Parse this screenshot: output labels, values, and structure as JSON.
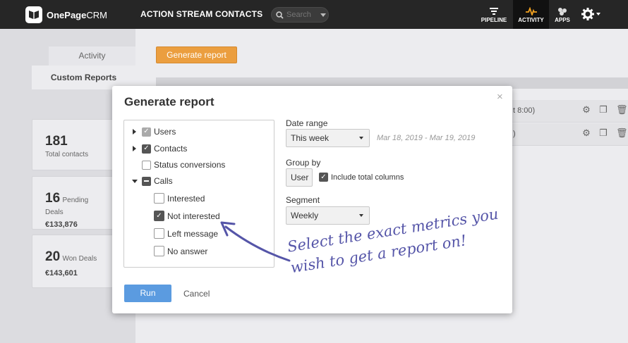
{
  "topbar": {
    "logo_bold": "OnePage",
    "logo_light": "CRM",
    "nav": [
      "ACTION STREAM",
      "CONTACTS"
    ],
    "search_placeholder": "Search",
    "right_nav": [
      {
        "label": "PIPELINE",
        "icon": "pipeline-icon"
      },
      {
        "label": "ACTIVITY",
        "icon": "activity-icon",
        "active": true
      },
      {
        "label": "APPS",
        "icon": "apps-icon"
      }
    ],
    "settings_icon": "gear-icon"
  },
  "sidebar": {
    "tab_activity": "Activity",
    "tab_custom": "Custom Reports",
    "stats": [
      {
        "value": "181",
        "label": "Total contacts",
        "money": ""
      },
      {
        "value": "16",
        "label": "Pending Deals",
        "money": "€133,876"
      },
      {
        "value": "20",
        "label": "Won Deals",
        "money": "€143,601"
      }
    ]
  },
  "main": {
    "generate_button": "Generate report",
    "rows": [
      {
        "text": "t 8:00)"
      },
      {
        "text": ")"
      }
    ]
  },
  "modal": {
    "title": "Generate report",
    "close": "×",
    "tree": [
      {
        "label": "Users",
        "expander": "right",
        "state": "grey"
      },
      {
        "label": "Contacts",
        "expander": "right",
        "state": "checked"
      },
      {
        "label": "Status conversions",
        "expander": "",
        "state": "unchecked"
      },
      {
        "label": "Calls",
        "expander": "down",
        "state": "mixed"
      },
      {
        "label": "Interested",
        "state": "unchecked"
      },
      {
        "label": "Not interested",
        "state": "checked"
      },
      {
        "label": "Left message",
        "state": "unchecked"
      },
      {
        "label": "No answer",
        "state": "unchecked"
      }
    ],
    "date_range_label": "Date range",
    "date_range_value": "This week",
    "date_range_hint": "Mar 18, 2019 - Mar 19, 2019",
    "group_by_label": "Group by",
    "group_by_value": "User",
    "include_total_label": "Include total columns",
    "segment_label": "Segment",
    "segment_value": "Weekly",
    "run_label": "Run",
    "cancel_label": "Cancel"
  },
  "annotation": {
    "line1": "Select the exact metrics you",
    "line2": "wish to get a report on!"
  },
  "colors": {
    "topbar": "#262626",
    "accent_orange": "#eb9e3f",
    "run_blue": "#5b9be0",
    "annotation": "#5555a8"
  }
}
